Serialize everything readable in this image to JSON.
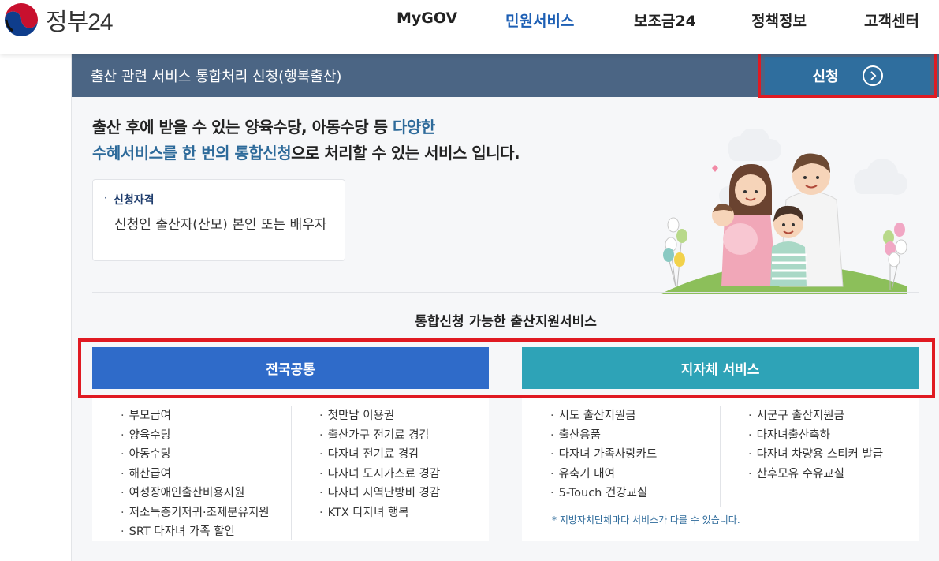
{
  "header": {
    "logo_text": "정부24",
    "nav": [
      "MyGOV",
      "민원서비스",
      "보조금24",
      "정책정보",
      "고객센터"
    ],
    "active_nav": "민원서비스"
  },
  "panel": {
    "title": "출산 관련 서비스 통합처리 신청(행복출산)",
    "apply_label": "신청",
    "intro_line1_plain": "출산 후에 받을 수 있는 양육수당, 아동수당 등 ",
    "intro_line1_highlight": "다양한",
    "intro_line2_highlight": "수혜서비스를 한 번의 통합신청",
    "intro_line2_plain": "으로 처리할 수 있는 서비스 입니다.",
    "eligibility": {
      "title": "신청자격",
      "text": "신청인 출산자(산모) 본인 또는 배우자"
    },
    "section_title": "통합신청 가능한 출산지원서비스",
    "tabs": {
      "national": "전국공통",
      "local": "지자체 서비스"
    },
    "national_col1": [
      "부모급여",
      "양육수당",
      "아동수당",
      "해산급여",
      "여성장애인출산비용지원",
      "저소득층기저귀·조제분유지원",
      "SRT 다자녀 가족 할인"
    ],
    "national_col2": [
      "첫만남 이용권",
      "출산가구 전기료 경감",
      "다자녀 전기료 경감",
      "다자녀 도시가스료 경감",
      "다자녀 지역난방비 경감",
      "KTX 다자녀 행복"
    ],
    "local_col1": [
      "시도 출산지원금",
      "출산용품",
      "다자녀 가족사랑카드",
      "유축기 대여",
      "5-Touch 건강교실"
    ],
    "local_col2": [
      "시군구 출산지원금",
      "다자녀출산축하",
      "다자녀 차량용 스티커 발급",
      "산후모유 수유교실"
    ],
    "local_note": "* 지방자치단체마다 서비스가 다를 수 있습니다.",
    "bullet": "·"
  },
  "colors": {
    "title_bar": "#4b6584",
    "apply_button": "#2f6e9e",
    "highlight_border": "#e01a22",
    "tab_national": "#2f6bc9",
    "tab_local": "#2ea3b7",
    "active_nav": "#1d5fb4"
  }
}
